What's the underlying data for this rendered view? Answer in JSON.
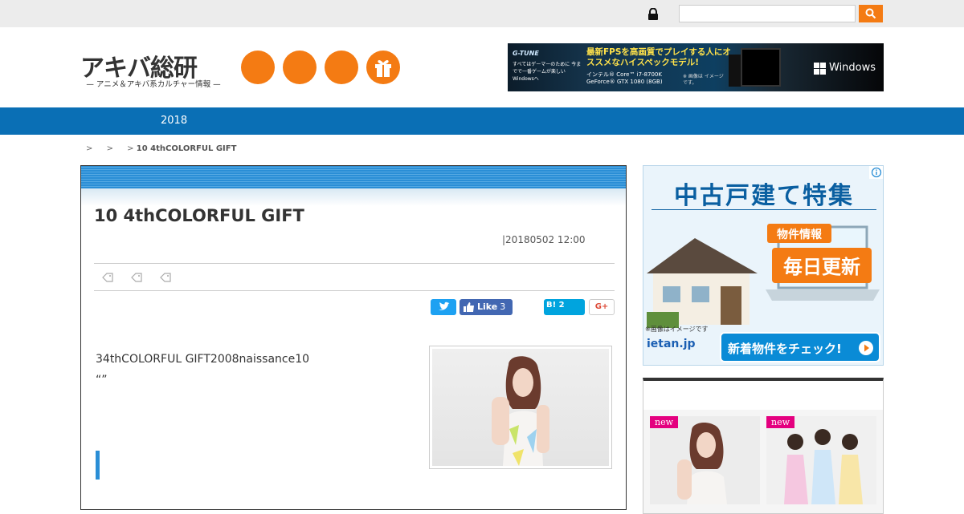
{
  "topbar": {
    "search_placeholder": "",
    "lock_icon": "lock-icon",
    "search_icon": "search-icon"
  },
  "header": {
    "logo_text": "アキバ総研",
    "logo_subtitle": "— アニメ＆アキバ系カルチャー情報 —",
    "social_icons": [
      "orange-circle-icon",
      "orange-circle-icon",
      "orange-circle-icon",
      "gift-icon"
    ],
    "accent_color": "#f47b13"
  },
  "banner": {
    "brand": "G-TUNE",
    "tagline": "すべてはゲーマーのために 今までで一番ゲームが楽しい Windowsへ",
    "headline": "最新FPSを高画質でプレイする人にオススメなハイスペックモデル!",
    "specs": "インテル® Core™ i7-8700K GeForce® GTX 1080 (8GB)",
    "note": "※ 画像は イメージです。",
    "windows_label": "Windows"
  },
  "nav": {
    "year_label": "2018",
    "color": "#0a6fb5"
  },
  "breadcrumb": {
    "separators": [
      ">",
      ">",
      ">"
    ],
    "current": "10 4thCOLORFUL GIFT"
  },
  "article": {
    "title": "10 4thCOLORFUL GIFT",
    "date": "|20180502 12:00",
    "tag_icons": [
      "tag-icon",
      "tag-icon",
      "tag-icon"
    ],
    "share": {
      "twitter_icon": "twitter-icon",
      "facebook_label": "Like",
      "facebook_count": "3",
      "hatena_label": "B!",
      "hatena_count": "2",
      "googleplus_label": "G+"
    },
    "body_line1": "34thCOLORFUL GIFT2008naissance10",
    "body_line2": "“”"
  },
  "sidebar_ad": {
    "title": "中古戸建て特集",
    "badge_label": "物件情報",
    "badge_main": "毎日更新",
    "note": "※画像はイメージです",
    "button_label": "新着物件をチェック!",
    "logo": "ietan.jp"
  },
  "widget": {
    "title": "",
    "items": [
      {
        "badge": "new"
      },
      {
        "badge": "new"
      }
    ]
  }
}
